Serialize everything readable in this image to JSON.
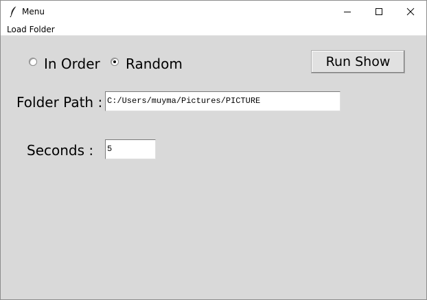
{
  "window": {
    "title": "Menu",
    "icon": "feather-icon",
    "controls": {
      "minimize": "minimize-icon",
      "maximize": "maximize-icon",
      "close": "close-icon"
    }
  },
  "menubar": {
    "items": [
      {
        "label": "Load Folder"
      }
    ]
  },
  "order_options": {
    "selected": "Random",
    "options": [
      {
        "label": "In Order",
        "selected": false
      },
      {
        "label": "Random",
        "selected": true
      }
    ]
  },
  "run_button": {
    "label": "Run Show"
  },
  "folder": {
    "label": "Folder Path :",
    "value": "C:/Users/muyma/Pictures/PICTURE"
  },
  "seconds": {
    "label": "Seconds :",
    "value": "5"
  },
  "colors": {
    "window_bg": "#d9d9d9",
    "titlebar_bg": "#ffffff",
    "entry_bg": "#ffffff"
  }
}
